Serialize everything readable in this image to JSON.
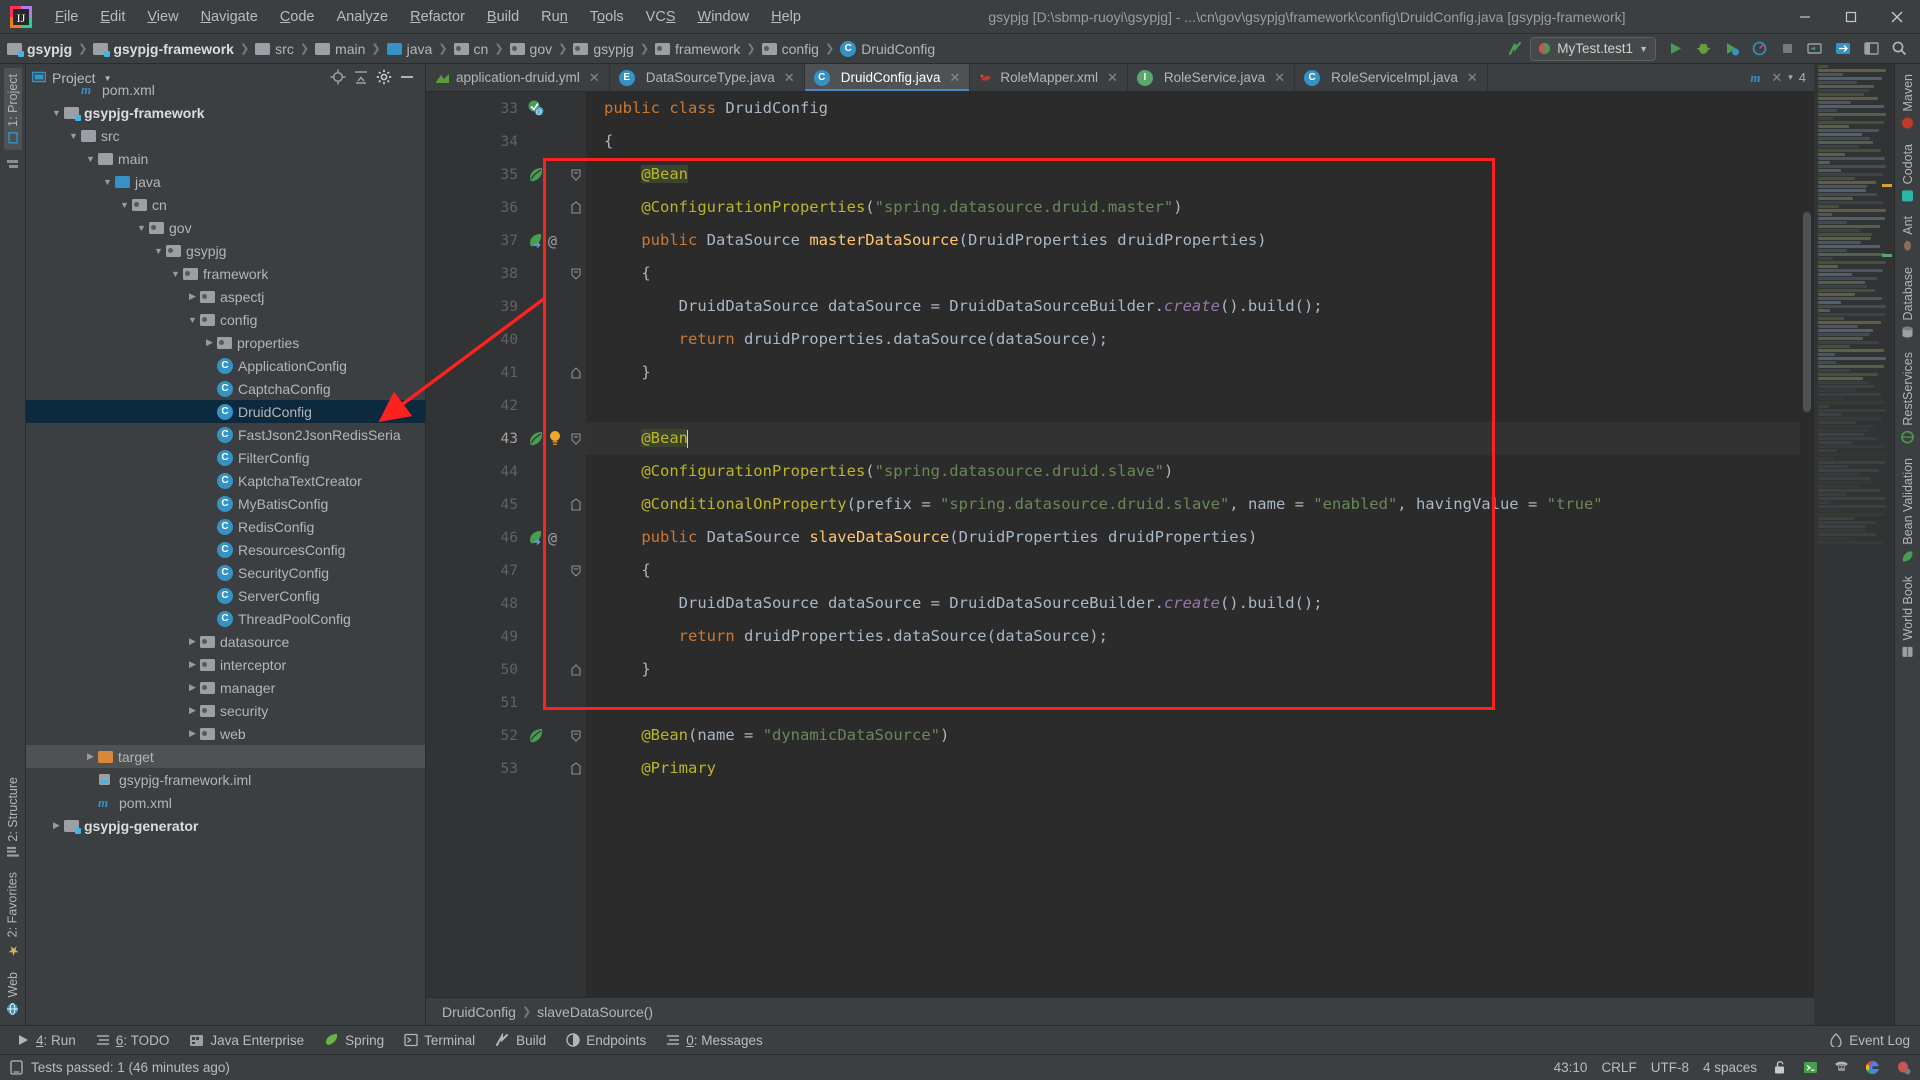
{
  "titlebar": {
    "menu": [
      "File",
      "Edit",
      "View",
      "Navigate",
      "Code",
      "Analyze",
      "Refactor",
      "Build",
      "Run",
      "Tools",
      "VCS",
      "Window",
      "Help"
    ],
    "title": "gsypjg [D:\\sbmp-ruoyi\\gsypjg] - ...\\cn\\gov\\gsypjg\\framework\\config\\DruidConfig.java [gsypjg-framework]",
    "minimize": "—",
    "maximize": "▢",
    "close": "✕"
  },
  "navbar": {
    "crumbs": [
      {
        "label": "gsypjg",
        "icon": "module-icon",
        "bold": true
      },
      {
        "label": "gsypjg-framework",
        "icon": "module-icon",
        "bold": true
      },
      {
        "label": "src",
        "icon": "folder-icon",
        "bold": false
      },
      {
        "label": "main",
        "icon": "folder-icon",
        "bold": false
      },
      {
        "label": "java",
        "icon": "source-folder-icon",
        "bold": false
      },
      {
        "label": "cn",
        "icon": "package-icon",
        "bold": false
      },
      {
        "label": "gov",
        "icon": "package-icon",
        "bold": false
      },
      {
        "label": "gsypjg",
        "icon": "package-icon",
        "bold": false
      },
      {
        "label": "framework",
        "icon": "package-icon",
        "bold": false
      },
      {
        "label": "config",
        "icon": "package-icon",
        "bold": false
      },
      {
        "label": "DruidConfig",
        "icon": "class-icon",
        "bold": false
      }
    ],
    "run_config": "MyTest.test1",
    "buttons": [
      "build-icon",
      "run-icon",
      "debug-icon",
      "run-coverage-icon",
      "profile-icon",
      "stop-icon",
      "update-icon",
      "sync-icon",
      "layout-icon",
      "search-icon"
    ]
  },
  "project_panel": {
    "title": "Project",
    "header_icons": [
      "locate-icon",
      "collapse-all-icon",
      "settings-icon",
      "hide-icon"
    ],
    "tree": [
      {
        "label": "pom.xml",
        "depth": 2,
        "arrow": "",
        "icon": "maven-icon",
        "bold": false,
        "state": "none"
      },
      {
        "label": "gsypjg-framework",
        "depth": 1,
        "arrow": "▼",
        "icon": "module-icon",
        "bold": true,
        "state": "none"
      },
      {
        "label": "src",
        "depth": 2,
        "arrow": "▼",
        "icon": "folder-icon",
        "bold": false,
        "state": "none"
      },
      {
        "label": "main",
        "depth": 3,
        "arrow": "▼",
        "icon": "folder-icon",
        "bold": false,
        "state": "none"
      },
      {
        "label": "java",
        "depth": 4,
        "arrow": "▼",
        "icon": "source-folder-icon",
        "bold": false,
        "state": "none"
      },
      {
        "label": "cn",
        "depth": 5,
        "arrow": "▼",
        "icon": "package-icon",
        "bold": false,
        "state": "none"
      },
      {
        "label": "gov",
        "depth": 6,
        "arrow": "▼",
        "icon": "package-icon",
        "bold": false,
        "state": "none"
      },
      {
        "label": "gsypjg",
        "depth": 7,
        "arrow": "▼",
        "icon": "package-icon",
        "bold": false,
        "state": "none"
      },
      {
        "label": "framework",
        "depth": 8,
        "arrow": "▼",
        "icon": "package-icon",
        "bold": false,
        "state": "none"
      },
      {
        "label": "aspectj",
        "depth": 9,
        "arrow": "▶",
        "icon": "package-icon",
        "bold": false,
        "state": "none"
      },
      {
        "label": "config",
        "depth": 9,
        "arrow": "▼",
        "icon": "package-icon",
        "bold": false,
        "state": "none"
      },
      {
        "label": "properties",
        "depth": 10,
        "arrow": "▶",
        "icon": "package-icon",
        "bold": false,
        "state": "none"
      },
      {
        "label": "ApplicationConfig",
        "depth": 10,
        "arrow": "",
        "icon": "class-icon",
        "bold": false,
        "state": "none"
      },
      {
        "label": "CaptchaConfig",
        "depth": 10,
        "arrow": "",
        "icon": "class-icon",
        "bold": false,
        "state": "none"
      },
      {
        "label": "DruidConfig",
        "depth": 10,
        "arrow": "",
        "icon": "class-icon",
        "bold": false,
        "state": "selected"
      },
      {
        "label": "FastJson2JsonRedisSeria",
        "depth": 10,
        "arrow": "",
        "icon": "class-icon",
        "bold": false,
        "state": "none"
      },
      {
        "label": "FilterConfig",
        "depth": 10,
        "arrow": "",
        "icon": "class-icon",
        "bold": false,
        "state": "none"
      },
      {
        "label": "KaptchaTextCreator",
        "depth": 10,
        "arrow": "",
        "icon": "class-icon",
        "bold": false,
        "state": "none"
      },
      {
        "label": "MyBatisConfig",
        "depth": 10,
        "arrow": "",
        "icon": "class-icon",
        "bold": false,
        "state": "none"
      },
      {
        "label": "RedisConfig",
        "depth": 10,
        "arrow": "",
        "icon": "class-icon",
        "bold": false,
        "state": "none"
      },
      {
        "label": "ResourcesConfig",
        "depth": 10,
        "arrow": "",
        "icon": "class-icon",
        "bold": false,
        "state": "none"
      },
      {
        "label": "SecurityConfig",
        "depth": 10,
        "arrow": "",
        "icon": "class-icon",
        "bold": false,
        "state": "none"
      },
      {
        "label": "ServerConfig",
        "depth": 10,
        "arrow": "",
        "icon": "class-icon",
        "bold": false,
        "state": "none"
      },
      {
        "label": "ThreadPoolConfig",
        "depth": 10,
        "arrow": "",
        "icon": "class-icon",
        "bold": false,
        "state": "none"
      },
      {
        "label": "datasource",
        "depth": 9,
        "arrow": "▶",
        "icon": "package-icon",
        "bold": false,
        "state": "none"
      },
      {
        "label": "interceptor",
        "depth": 9,
        "arrow": "▶",
        "icon": "package-icon",
        "bold": false,
        "state": "none"
      },
      {
        "label": "manager",
        "depth": 9,
        "arrow": "▶",
        "icon": "package-icon",
        "bold": false,
        "state": "none"
      },
      {
        "label": "security",
        "depth": 9,
        "arrow": "▶",
        "icon": "package-icon",
        "bold": false,
        "state": "none"
      },
      {
        "label": "web",
        "depth": 9,
        "arrow": "▶",
        "icon": "package-icon",
        "bold": false,
        "state": "none"
      },
      {
        "label": "target",
        "depth": 3,
        "arrow": "▶",
        "icon": "folder-orange-icon",
        "bold": false,
        "state": "hover"
      },
      {
        "label": "gsypjg-framework.iml",
        "depth": 3,
        "arrow": "",
        "icon": "iml-icon",
        "bold": false,
        "state": "none"
      },
      {
        "label": "pom.xml",
        "depth": 3,
        "arrow": "",
        "icon": "maven-icon",
        "bold": false,
        "state": "none"
      },
      {
        "label": "gsypjg-generator",
        "depth": 1,
        "arrow": "▶",
        "icon": "module-icon",
        "bold": true,
        "state": "none"
      }
    ]
  },
  "left_stripe": [
    {
      "label": "1: Project",
      "icon": "project-icon",
      "selected": true
    },
    {
      "label": "2: Structure",
      "icon": "structure-icon",
      "selected": false
    },
    {
      "label": "2: Favorites",
      "icon": "favorites-icon",
      "selected": false
    },
    {
      "label": "Web",
      "icon": "web-icon",
      "selected": false
    }
  ],
  "right_stripe": [
    {
      "label": "Maven",
      "icon": "maven-icon"
    },
    {
      "label": "Codota",
      "icon": "codota-icon"
    },
    {
      "label": "Ant",
      "icon": "ant-icon"
    },
    {
      "label": "Database",
      "icon": "database-icon"
    },
    {
      "label": "RestServices",
      "icon": "rest-icon"
    },
    {
      "label": "Bean Validation",
      "icon": "bean-icon"
    },
    {
      "label": "World Book",
      "icon": "book-icon"
    }
  ],
  "editor": {
    "tabs": [
      {
        "label": "application-druid.yml",
        "icon": "yaml-icon",
        "active": false
      },
      {
        "label": "DataSourceType.java",
        "icon": "enum-icon",
        "active": false
      },
      {
        "label": "DruidConfig.java",
        "icon": "class-icon",
        "active": true
      },
      {
        "label": "RoleMapper.xml",
        "icon": "mybatis-icon",
        "active": false
      },
      {
        "label": "RoleService.java",
        "icon": "interface-icon",
        "active": false
      },
      {
        "label": "RoleServiceImpl.java",
        "icon": "class-icon",
        "active": false
      }
    ],
    "tab_overflow": "4",
    "first_line_number": 33,
    "lines": [
      {
        "n": 33,
        "indent": 0,
        "tokens": [
          {
            "t": "public ",
            "c": "kw"
          },
          {
            "t": "class ",
            "c": "kw"
          },
          {
            "t": "DruidConfig",
            "c": "id"
          }
        ],
        "gutter": [
          "override-icon"
        ],
        "fold": ""
      },
      {
        "n": 34,
        "indent": 0,
        "tokens": [
          {
            "t": "{",
            "c": "par"
          }
        ],
        "gutter": [],
        "fold": ""
      },
      {
        "n": 35,
        "indent": 1,
        "tokens": [
          {
            "t": "@Bean",
            "c": "ann hl"
          }
        ],
        "gutter": [
          "bean-icon"
        ],
        "fold": "▽"
      },
      {
        "n": 36,
        "indent": 1,
        "tokens": [
          {
            "t": "@ConfigurationProperties",
            "c": "ann"
          },
          {
            "t": "(",
            "c": "par"
          },
          {
            "t": "\"spring.datasource.druid.master\"",
            "c": "str"
          },
          {
            "t": ")",
            "c": "par"
          }
        ],
        "gutter": [],
        "fold": "⌂"
      },
      {
        "n": 37,
        "indent": 1,
        "tokens": [
          {
            "t": "public ",
            "c": "kw"
          },
          {
            "t": "DataSource ",
            "c": "id"
          },
          {
            "t": "masterDataSource",
            "c": "fn"
          },
          {
            "t": "(",
            "c": "par"
          },
          {
            "t": "DruidProperties druidProperties",
            "c": "id"
          },
          {
            "t": ")",
            "c": "par"
          }
        ],
        "gutter": [
          "bean-nav-icon",
          "at-icon"
        ],
        "fold": ""
      },
      {
        "n": 38,
        "indent": 1,
        "tokens": [
          {
            "t": "{",
            "c": "par"
          }
        ],
        "gutter": [],
        "fold": "▽"
      },
      {
        "n": 39,
        "indent": 2,
        "tokens": [
          {
            "t": "DruidDataSource dataSource ",
            "c": "id"
          },
          {
            "t": "= ",
            "c": "par"
          },
          {
            "t": "DruidDataSourceBuilder.",
            "c": "id"
          },
          {
            "t": "create",
            "c": "stat"
          },
          {
            "t": "().build();",
            "c": "id"
          }
        ],
        "gutter": [],
        "fold": ""
      },
      {
        "n": 40,
        "indent": 2,
        "tokens": [
          {
            "t": "return ",
            "c": "kw"
          },
          {
            "t": "druidProperties.dataSource(dataSource);",
            "c": "id"
          }
        ],
        "gutter": [],
        "fold": ""
      },
      {
        "n": 41,
        "indent": 1,
        "tokens": [
          {
            "t": "}",
            "c": "par"
          }
        ],
        "gutter": [],
        "fold": "△"
      },
      {
        "n": 42,
        "indent": 0,
        "tokens": [],
        "gutter": [],
        "fold": ""
      },
      {
        "n": 43,
        "indent": 1,
        "tokens": [
          {
            "t": "@Bean",
            "c": "ann hl"
          }
        ],
        "gutter": [
          "bean-icon",
          "bulb-icon"
        ],
        "fold": "▽",
        "current": true
      },
      {
        "n": 44,
        "indent": 1,
        "tokens": [
          {
            "t": "@ConfigurationProperties",
            "c": "ann"
          },
          {
            "t": "(",
            "c": "par"
          },
          {
            "t": "\"spring.datasource.druid.slave\"",
            "c": "str"
          },
          {
            "t": ")",
            "c": "par"
          }
        ],
        "gutter": [],
        "fold": ""
      },
      {
        "n": 45,
        "indent": 1,
        "tokens": [
          {
            "t": "@ConditionalOnProperty",
            "c": "ann"
          },
          {
            "t": "(",
            "c": "par"
          },
          {
            "t": "prefix ",
            "c": "id"
          },
          {
            "t": "= ",
            "c": "par"
          },
          {
            "t": "\"spring.datasource.druid.slave\"",
            "c": "str"
          },
          {
            "t": ", ",
            "c": "par"
          },
          {
            "t": "name ",
            "c": "id"
          },
          {
            "t": "= ",
            "c": "par"
          },
          {
            "t": "\"enabled\"",
            "c": "str"
          },
          {
            "t": ", ",
            "c": "par"
          },
          {
            "t": "havingValue ",
            "c": "id"
          },
          {
            "t": "= ",
            "c": "par"
          },
          {
            "t": "\"true\"",
            "c": "str"
          }
        ],
        "gutter": [],
        "fold": "⌂"
      },
      {
        "n": 46,
        "indent": 1,
        "tokens": [
          {
            "t": "public ",
            "c": "kw"
          },
          {
            "t": "DataSource ",
            "c": "id"
          },
          {
            "t": "slaveDataSource",
            "c": "fn"
          },
          {
            "t": "(",
            "c": "par"
          },
          {
            "t": "DruidProperties druidProperties",
            "c": "id"
          },
          {
            "t": ")",
            "c": "par"
          }
        ],
        "gutter": [
          "bean-nav-icon",
          "at-icon"
        ],
        "fold": ""
      },
      {
        "n": 47,
        "indent": 1,
        "tokens": [
          {
            "t": "{",
            "c": "par"
          }
        ],
        "gutter": [],
        "fold": "▽"
      },
      {
        "n": 48,
        "indent": 2,
        "tokens": [
          {
            "t": "DruidDataSource dataSource ",
            "c": "id"
          },
          {
            "t": "= ",
            "c": "par"
          },
          {
            "t": "DruidDataSourceBuilder.",
            "c": "id"
          },
          {
            "t": "create",
            "c": "stat"
          },
          {
            "t": "().build();",
            "c": "id"
          }
        ],
        "gutter": [],
        "fold": ""
      },
      {
        "n": 49,
        "indent": 2,
        "tokens": [
          {
            "t": "return ",
            "c": "kw"
          },
          {
            "t": "druidProperties.dataSource(dataSource);",
            "c": "id"
          }
        ],
        "gutter": [],
        "fold": ""
      },
      {
        "n": 50,
        "indent": 1,
        "tokens": [
          {
            "t": "}",
            "c": "par"
          }
        ],
        "gutter": [],
        "fold": "△"
      },
      {
        "n": 51,
        "indent": 0,
        "tokens": [],
        "gutter": [],
        "fold": ""
      },
      {
        "n": 52,
        "indent": 1,
        "tokens": [
          {
            "t": "@Bean",
            "c": "ann"
          },
          {
            "t": "(",
            "c": "par"
          },
          {
            "t": "name ",
            "c": "id"
          },
          {
            "t": "= ",
            "c": "par"
          },
          {
            "t": "\"dynamicDataSource\"",
            "c": "str"
          },
          {
            "t": ")",
            "c": "par"
          }
        ],
        "gutter": [
          "bean-icon"
        ],
        "fold": "▽"
      },
      {
        "n": 53,
        "indent": 1,
        "tokens": [
          {
            "t": "@Primary",
            "c": "ann"
          }
        ],
        "gutter": [],
        "fold": "⌂"
      }
    ],
    "breadcrumb": [
      "DruidConfig",
      "slaveDataSource()"
    ]
  },
  "bottom_toolbar": [
    {
      "label": "4: Run",
      "icon": "run-icon",
      "mnemonic": "4"
    },
    {
      "label": "6: TODO",
      "icon": "todo-icon",
      "mnemonic": "6"
    },
    {
      "label": "Java Enterprise",
      "icon": "java-ee-icon",
      "mnemonic": ""
    },
    {
      "label": "Spring",
      "icon": "spring-icon",
      "mnemonic": ""
    },
    {
      "label": "Terminal",
      "icon": "terminal-icon",
      "mnemonic": ""
    },
    {
      "label": "Build",
      "icon": "build-icon",
      "mnemonic": ""
    },
    {
      "label": "Endpoints",
      "icon": "endpoints-icon",
      "mnemonic": ""
    },
    {
      "label": "0: Messages",
      "icon": "messages-icon",
      "mnemonic": "0"
    }
  ],
  "event_log": "Event Log",
  "statusbar": {
    "message": "Tests passed: 1 (46 minutes ago)",
    "caret": "43:10",
    "line_sep": "CRLF",
    "encoding": "UTF-8",
    "indent": "4 spaces",
    "icons": [
      "lock-open-icon",
      "terminal-green-icon",
      "hacker-icon",
      "google-icon",
      "bug-settings-icon"
    ]
  },
  "colors": {
    "accent": "#3592c4",
    "annotation_red": "#ff2020",
    "selection": "#0d293e",
    "keyword": "#cc7832",
    "string": "#6a8759",
    "annotation_yellow": "#bbb529",
    "method": "#ffc66d"
  }
}
